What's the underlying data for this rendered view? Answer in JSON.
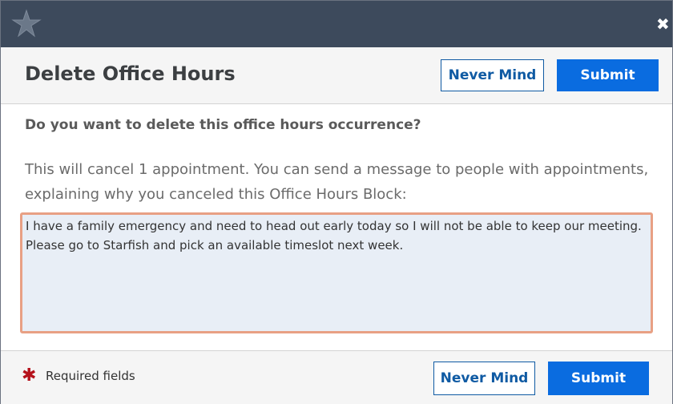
{
  "titlebar": {
    "logo_icon": "starfish-star-icon",
    "close_icon": "close-icon",
    "close_glyph": "✖"
  },
  "header": {
    "title": "Delete Office Hours",
    "never_mind_label": "Never Mind",
    "submit_label": "Submit"
  },
  "body": {
    "question": "Do you want to delete this office hours occurrence?",
    "info": "This will cancel 1 appointment. You can send a message to people with appointments, explaining why you canceled this Office Hours Block:",
    "message_value": "I have a family emergency and need to head out early today so I will not be able to keep our meeting.  Please go to Starfish and pick an available timeslot next week."
  },
  "footer": {
    "required_marker": "✱",
    "required_text": "Required fields",
    "never_mind_label": "Never Mind",
    "submit_label": "Submit"
  },
  "colors": {
    "titlebar_bg": "#3d4a5c",
    "primary_button": "#0a6ce0",
    "secondary_button_text": "#0f5aa3",
    "required_star": "#b5121b",
    "textarea_border": "#e8a084",
    "textarea_bg": "#e8eef6"
  }
}
